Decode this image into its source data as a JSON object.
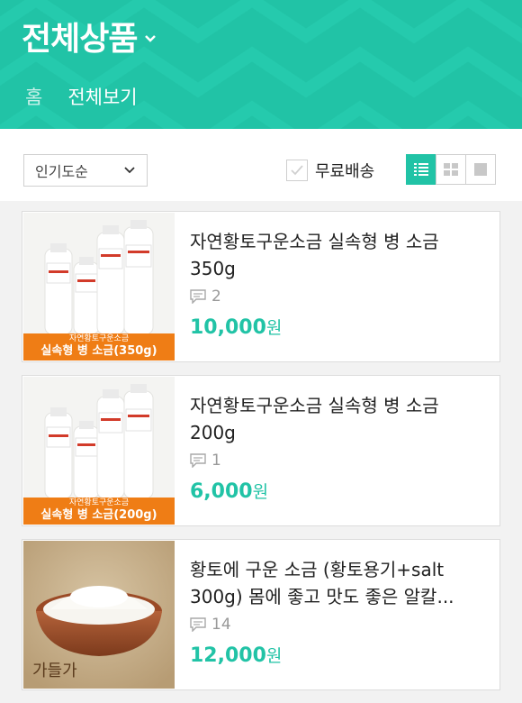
{
  "header": {
    "title": "전체상품",
    "nav": {
      "home": "홈",
      "all": "전체보기"
    }
  },
  "toolbar": {
    "sort_value": "인기도순",
    "free_shipping_label": "무료배송",
    "view_modes": [
      "list",
      "grid",
      "large"
    ],
    "active_view": "list"
  },
  "colors": {
    "accent": "#21c3a6",
    "banner": "#ef7d15"
  },
  "products": [
    {
      "name": "자연황토구운소금 실속형 병 소금 350g",
      "reviews": "2",
      "price": "10,000",
      "currency": "원",
      "banner_top": "자연황토구운소금",
      "banner_bottom": "실속형 병 소금(350g)"
    },
    {
      "name": "자연황토구운소금 실속형 병 소금 200g",
      "reviews": "1",
      "price": "6,000",
      "currency": "원",
      "banner_top": "자연황토구운소금",
      "banner_bottom": "실속형 병 소금(200g)"
    },
    {
      "name": "황토에 구운 소금 (황토용기+salt 300g) 몸에 좋고 맛도 좋은 알칼...",
      "reviews": "14",
      "price": "12,000",
      "currency": "원",
      "image_caption": "가들가"
    }
  ]
}
